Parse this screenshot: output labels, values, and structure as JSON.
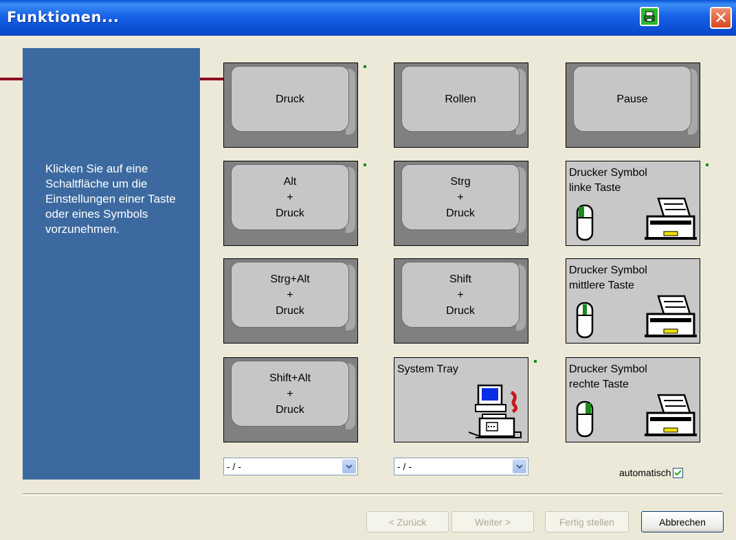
{
  "window": {
    "title": "Funktionen..."
  },
  "panel": {
    "text": "Klicken Sie auf eine Schaltfläche um die Einstellungen einer Taste oder eines Symbols vorzunehmen."
  },
  "keys": {
    "druck": "Druck",
    "rollen": "Rollen",
    "pause": "Pause",
    "alt_druck": "Alt\n+\nDruck",
    "strg_druck": "Strg\n+\nDruck",
    "strg_alt_druck": "Strg+Alt\n+\nDruck",
    "shift_druck": "Shift\n+\nDruck",
    "shift_alt_druck": "Shift+Alt\n+\nDruck"
  },
  "tiles": {
    "drucker_links": "Drucker Symbol\nlinke Taste",
    "drucker_mitte": "Drucker Symbol\nmittlere Taste",
    "drucker_rechts": "Drucker Symbol\nrechte Taste",
    "system_tray": "System Tray"
  },
  "selects": {
    "left_value": "- / -",
    "right_value": "- / -"
  },
  "auto": {
    "label": "automatisch",
    "checked": true
  },
  "buttons": {
    "back": "< Zurück",
    "next": "Weiter >",
    "finish": "Fertig stellen",
    "cancel": "Abbrechen"
  },
  "colors": {
    "title_bar": "#0a56d8",
    "panel": "#3c6aa0",
    "arrow": "#8b0a1e",
    "indicator": "#1a8a1a"
  }
}
